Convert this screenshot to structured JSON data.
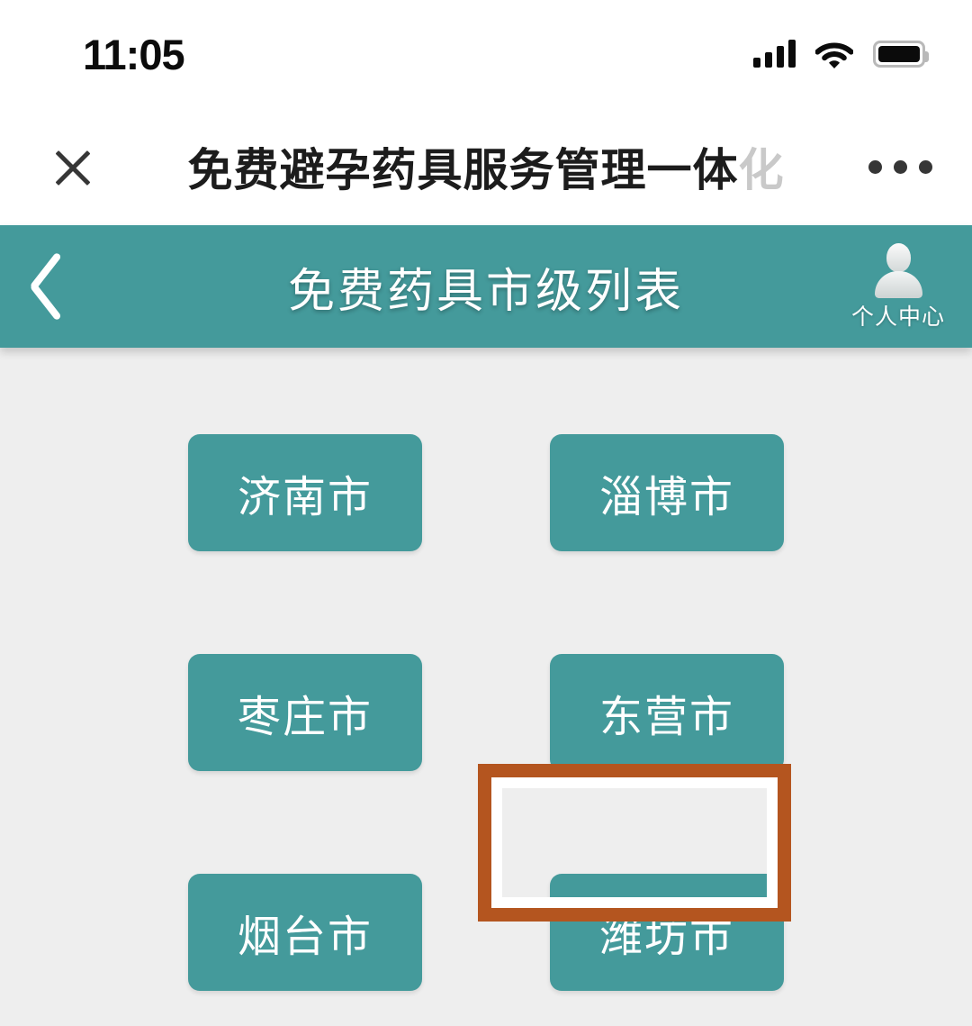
{
  "status_bar": {
    "time": "11:05",
    "signal_icon": "signal-bars-icon",
    "wifi_icon": "wifi-icon",
    "battery_icon": "battery-full-icon"
  },
  "wechat_nav": {
    "close_icon": "close-icon",
    "title_main": "免费避孕药具服务管理一体",
    "title_fade": "化",
    "more_icon": "more-options-icon"
  },
  "app_header": {
    "back_icon": "chevron-left-icon",
    "title": "免费药具市级列表",
    "profile_icon": "user-avatar-icon",
    "profile_label": "个人中心",
    "background_color": "#449a9b"
  },
  "content": {
    "background_color": "#eeeeee",
    "cities": [
      {
        "label": "济南市",
        "highlighted": false
      },
      {
        "label": "淄博市",
        "highlighted": true
      },
      {
        "label": "枣庄市",
        "highlighted": false
      },
      {
        "label": "东营市",
        "highlighted": false
      },
      {
        "label": "烟台市",
        "highlighted": false
      },
      {
        "label": "潍坊市",
        "highlighted": false
      }
    ]
  },
  "annotation": {
    "target": "淄博市",
    "color": "#b4551f"
  }
}
